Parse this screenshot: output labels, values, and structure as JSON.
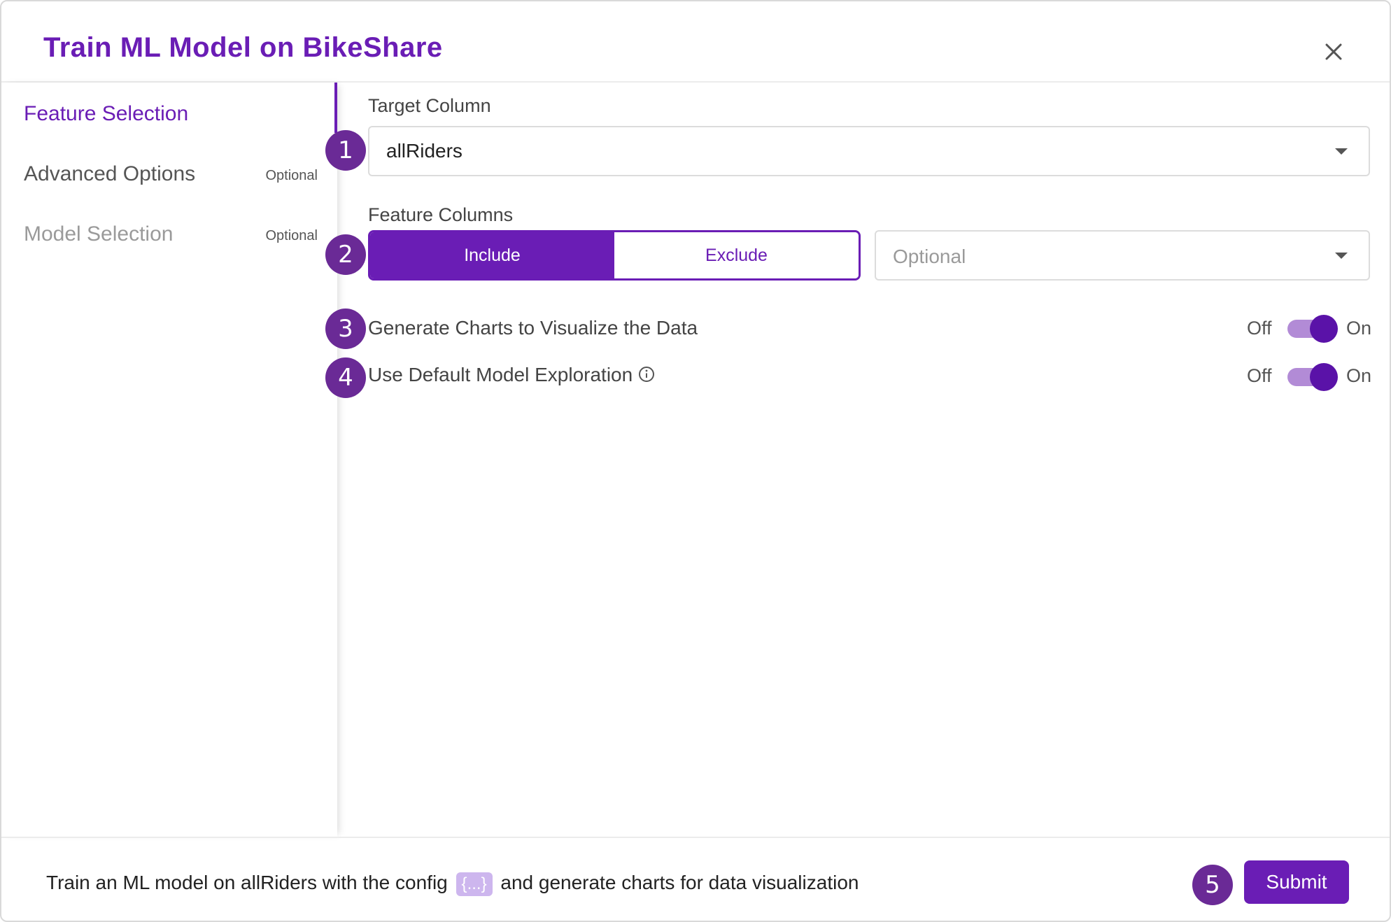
{
  "dialog": {
    "title": "Train ML Model on BikeShare"
  },
  "sidebar": {
    "items": [
      {
        "label": "Feature Selection",
        "optional": "",
        "active": true
      },
      {
        "label": "Advanced Options",
        "optional": "Optional",
        "active": false
      },
      {
        "label": "Model Selection",
        "optional": "Optional",
        "active": false
      }
    ]
  },
  "form": {
    "target_column": {
      "label": "Target Column",
      "value": "allRiders"
    },
    "feature_columns": {
      "label": "Feature Columns",
      "include_label": "Include",
      "exclude_label": "Exclude",
      "selected": "Include",
      "placeholder": "Optional"
    },
    "toggles": [
      {
        "label": "Generate Charts to Visualize the Data",
        "off_label": "Off",
        "on_label": "On",
        "state": "On"
      },
      {
        "label": "Use Default Model Exploration",
        "off_label": "Off",
        "on_label": "On",
        "state": "On"
      }
    ]
  },
  "footer": {
    "text_before": "Train an ML model on allRiders with the config",
    "config_chip": "{...}",
    "text_after": "and generate charts for data visualization",
    "submit_label": "Submit"
  },
  "badges": [
    "1",
    "2",
    "3",
    "4",
    "5"
  ],
  "colors": {
    "accent": "#6a1db5",
    "badge": "#6a2a96",
    "toggle_track": "#b28bd6",
    "chip": "#cdb6ee"
  }
}
